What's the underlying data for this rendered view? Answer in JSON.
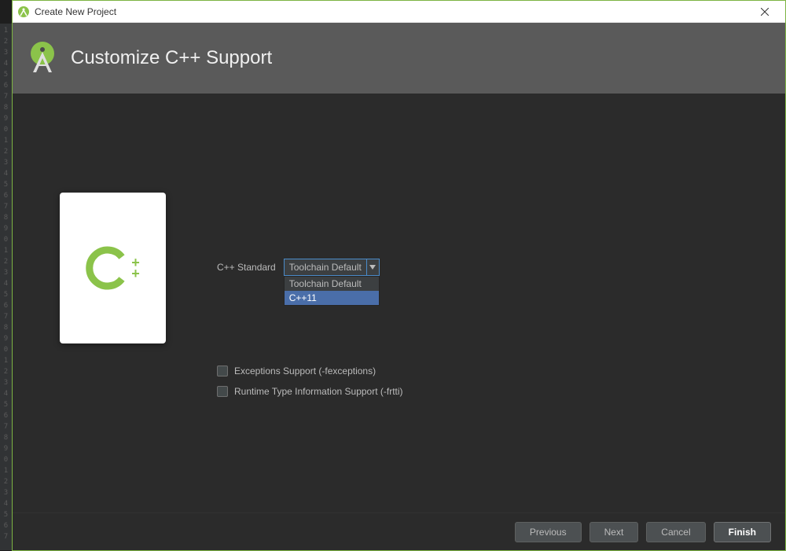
{
  "titlebar": {
    "title": "Create New Project"
  },
  "header": {
    "title": "Customize C++ Support"
  },
  "card": {
    "logo_main": "C",
    "logo_plus": "++"
  },
  "form": {
    "standard_label": "C++ Standard",
    "standard_selected": "Toolchain Default",
    "standard_options": [
      "Toolchain Default",
      "C++11"
    ]
  },
  "checkboxes": {
    "exceptions": "Exceptions Support (-fexceptions)",
    "rtti": "Runtime Type Information Support (-frtti)"
  },
  "buttons": {
    "previous": "Previous",
    "next": "Next",
    "cancel": "Cancel",
    "finish": "Finish"
  }
}
